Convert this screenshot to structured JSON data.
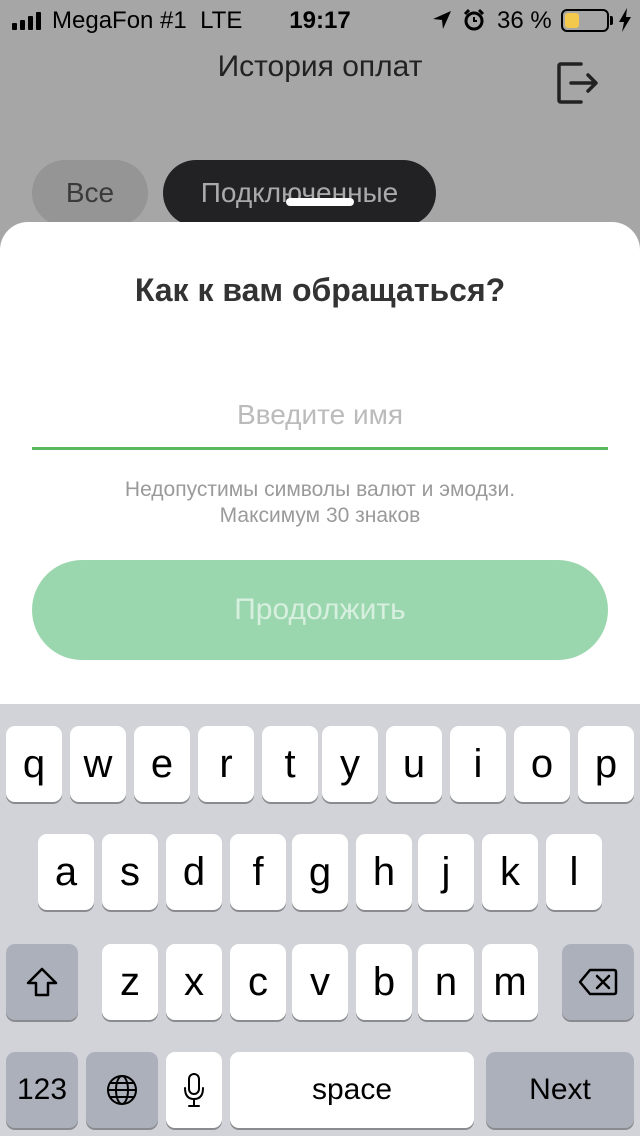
{
  "status_bar": {
    "carrier": "MegaFon #1  LTE",
    "time": "19:17",
    "battery_percent": "36 %",
    "battery_level": 0.36,
    "battery_color": "#f2c94c"
  },
  "app": {
    "title": "История оплат",
    "filters": [
      {
        "label": "Все",
        "selected": false
      },
      {
        "label": "Подключенные",
        "selected": true
      }
    ]
  },
  "sheet": {
    "title": "Как к вам обращаться?",
    "name_input": {
      "value": "",
      "placeholder": "Введите имя"
    },
    "hint_line1": "Недопустимы символы валют и эмодзи.",
    "hint_line2": "Максимум 30 знаков",
    "continue_label": "Продолжить",
    "accent_color": "#5cb85c"
  },
  "keyboard": {
    "row1": [
      "q",
      "w",
      "e",
      "r",
      "t",
      "y",
      "u",
      "i",
      "o",
      "p"
    ],
    "row2": [
      "a",
      "s",
      "d",
      "f",
      "g",
      "h",
      "j",
      "k",
      "l"
    ],
    "row3": [
      "z",
      "x",
      "c",
      "v",
      "b",
      "n",
      "m"
    ],
    "numbers_label": "123",
    "space_label": "space",
    "next_label": "Next"
  }
}
